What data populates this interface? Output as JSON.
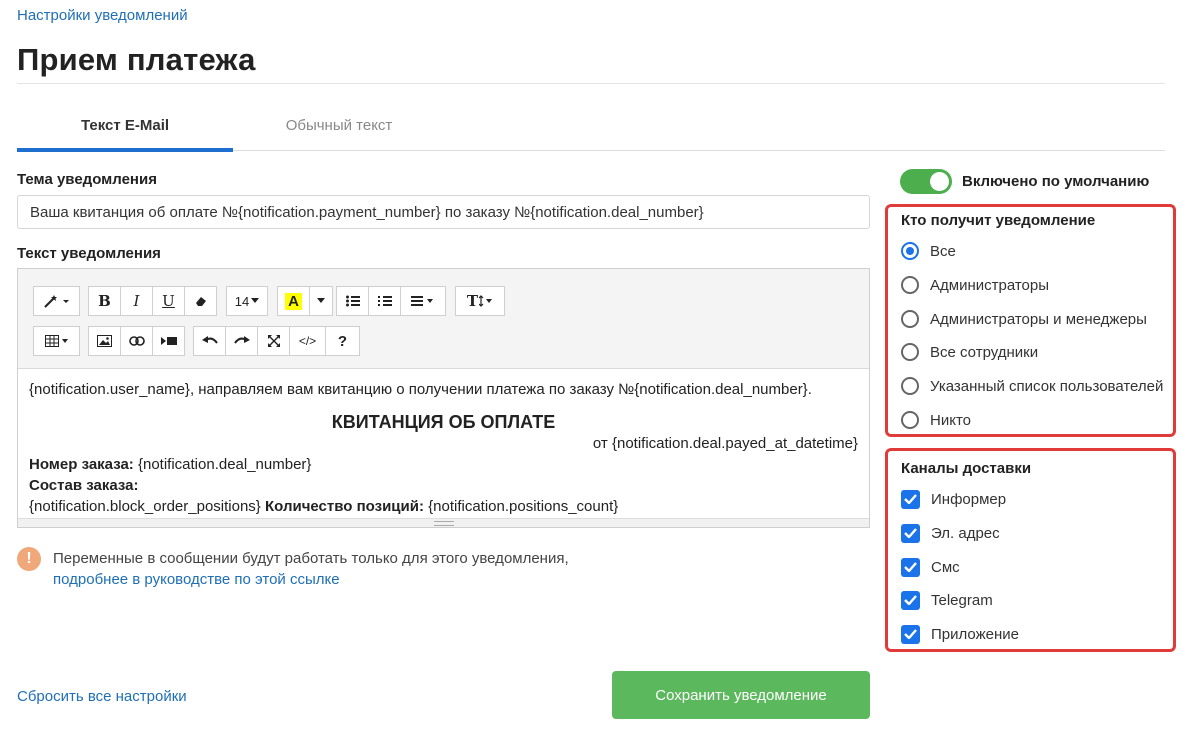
{
  "breadcrumb": "Настройки уведомлений",
  "page_title": "Прием платежа",
  "tabs": [
    {
      "label": "Текст E-Mail",
      "active": true
    },
    {
      "label": "Обычный текст",
      "active": false
    }
  ],
  "subject": {
    "label": "Тема уведомления",
    "value": "Ваша квитанция об оплате №{notification.payment_number} по заказу №{notification.deal_number}"
  },
  "body": {
    "label": "Текст уведомления",
    "toolbar": {
      "font_size": "14",
      "icons": [
        "magic-wand-icon",
        "bold-icon",
        "italic-icon",
        "underline-icon",
        "eraser-icon",
        "font-size-select",
        "highlight-color-icon",
        "dropdown-arrow-icon",
        "bullet-list-icon",
        "numbered-list-icon",
        "align-icon",
        "text-height-icon",
        "table-icon",
        "picture-icon",
        "link-icon",
        "video-icon",
        "undo-icon",
        "redo-icon",
        "fullscreen-icon",
        "code-view-icon",
        "help-icon"
      ],
      "bold": "B",
      "italic": "I",
      "underline": "U",
      "help": "?",
      "code": "</>",
      "text_height": "T"
    },
    "content": {
      "line1": "{notification.user_name}, направляем вам квитанцию о получении платежа по заказу №{notification.deal_number}.",
      "heading": "КВИТАНЦИЯ ОБ ОПЛАТЕ",
      "date_line": "от {notification.deal.payed_at_datetime}",
      "order_number_label": "Номер заказа:",
      "order_number_value": "{notification.deal_number}",
      "order_contents_label": "Состав заказа:",
      "positions_block": "{notification.block_order_positions}",
      "positions_count_label": "Количество позиций:",
      "positions_count_value": "{notification.positions_count}"
    }
  },
  "notice": {
    "icon": "!",
    "text": "Переменные в сообщении будут работать только для этого уведомления,",
    "link": "подробнее в руководстве по этой ссылке"
  },
  "footer": {
    "reset_link": "Сбросить все настройки",
    "save_button": "Сохранить уведомление"
  },
  "toggle": {
    "label": "Включено по умолчанию",
    "on": true
  },
  "recipients": {
    "title": "Кто получит уведомление",
    "selected": 0,
    "options": [
      "Все",
      "Администраторы",
      "Администраторы и менеджеры",
      "Все сотрудники",
      "Указанный список пользователей",
      "Никто"
    ]
  },
  "channels": {
    "title": "Каналы доставки",
    "options": [
      {
        "label": "Информер",
        "checked": true
      },
      {
        "label": "Эл. адрес",
        "checked": true
      },
      {
        "label": "Смс",
        "checked": true
      },
      {
        "label": "Telegram",
        "checked": true
      },
      {
        "label": "Приложение",
        "checked": true
      }
    ]
  },
  "colors": {
    "accent": "#1f6fd1",
    "link": "#1f6fb5",
    "save": "#5cb85c",
    "highlight_box": "#e03b3b",
    "toggle": "#4cae4c"
  }
}
